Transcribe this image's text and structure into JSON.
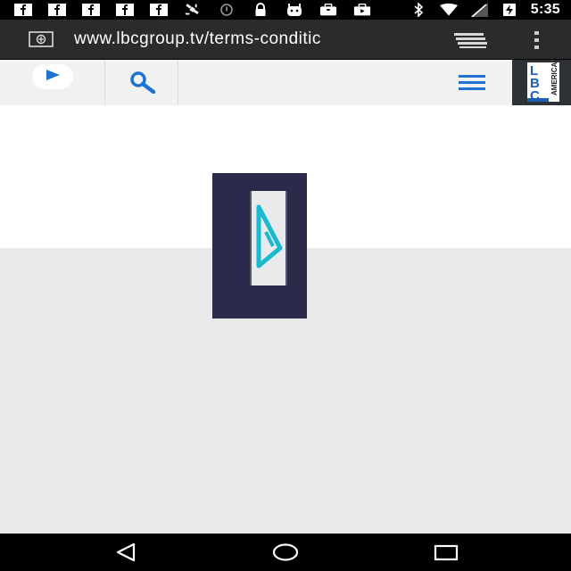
{
  "status_bar": {
    "time": "5:35",
    "left_icons": [
      "facebook-icon",
      "facebook-icon",
      "facebook-icon",
      "facebook-icon",
      "facebook-icon",
      "satellite-icon",
      "alert-circle-icon",
      "lock-icon",
      "android-icon",
      "briefcase-icon",
      "video-icon"
    ],
    "right_icons": [
      "bluetooth-icon",
      "wifi-icon",
      "signal-icon",
      "battery-charging-icon"
    ]
  },
  "browser": {
    "url": "www.lbcgroup.tv/terms-conditic",
    "load_progress": 0.87,
    "accent_color": "#33b5e5"
  },
  "site_toolbar": {
    "logo_letters": [
      "L",
      "B",
      "C"
    ],
    "logo_subtext": "AMERICA",
    "accent_color": "#1e73d2"
  },
  "loader": {
    "background_color": "#2b2a4a",
    "icon_color": "#19b9d0"
  },
  "nav_bar": {
    "buttons": [
      "back",
      "home",
      "recents"
    ]
  }
}
